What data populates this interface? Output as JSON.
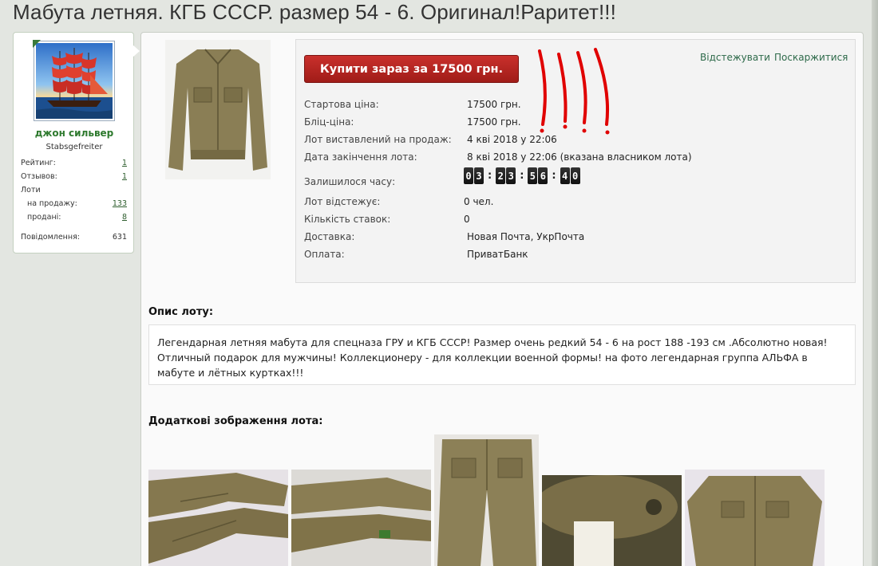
{
  "page": {
    "title": "Мабута летняя. КГБ СССР. размер 54 - 6. Оригинал!Раритет!!!"
  },
  "seller": {
    "name": "джон сильвер",
    "rank": "Stabsgefreiter",
    "avatar_icon": "sailing-ship-image",
    "stats": {
      "rating_label": "Рейтинг:",
      "rating_value": "1",
      "reviews_label": "Отзывов:",
      "reviews_value": "1",
      "lots_label": "Лоти",
      "on_sale_label": "на продажу:",
      "on_sale_value": "133",
      "sold_label": "продані:",
      "sold_value": "8",
      "messages_label": "Повідомлення:",
      "messages_value": "631"
    }
  },
  "lot": {
    "buy_button_label": "Купити зараз за 17500 грн.",
    "watch_link": "Відстежувати",
    "complain_link": "Поскаржитися",
    "fields": [
      {
        "label": "Стартова ціна:",
        "value": "17500 грн."
      },
      {
        "label": "Бліц-ціна:",
        "value": "17500 грн."
      },
      {
        "label": "Лот виставлений на продаж:",
        "value": "4 кві 2018 у 22:06"
      },
      {
        "label": "Дата закінчення лота:",
        "value": "8 кві 2018 у 22:06 (вказана власником лота)"
      }
    ],
    "time_left_label": "Залишилося часу:",
    "timer": {
      "days": [
        "0",
        "3"
      ],
      "hours": [
        "2",
        "3"
      ],
      "minutes": [
        "5",
        "6"
      ],
      "seconds": [
        "4",
        "0"
      ],
      "separator": ":"
    },
    "fields2": [
      {
        "label": "Лот відстежує:",
        "value": "0 чел."
      },
      {
        "label": "Кількість ставок:",
        "value": "0"
      },
      {
        "label": "Доставка:",
        "value": "Новая Почта, УкрПочта"
      },
      {
        "label": "Оплата:",
        "value": "ПриватБанк"
      }
    ]
  },
  "description": {
    "heading": "Опис лоту:",
    "text": "Легендарная летняя мабута для спецназа ГРУ и КГБ СССР! Размер очень редкий 54 - 6 на рост 188 -193 см .Абсолютно новая! Отличный подарок для мужчины! Коллекционеру - для коллекции военной формы! на фото легендарная группа АЛЬФА в мабуте и лётных куртках!!!"
  },
  "extra_images": {
    "heading": "Додаткові зображення лота:"
  },
  "colors": {
    "buy_button": "#b32420",
    "link": "#2e6a4a",
    "annotation": "#e00000"
  }
}
